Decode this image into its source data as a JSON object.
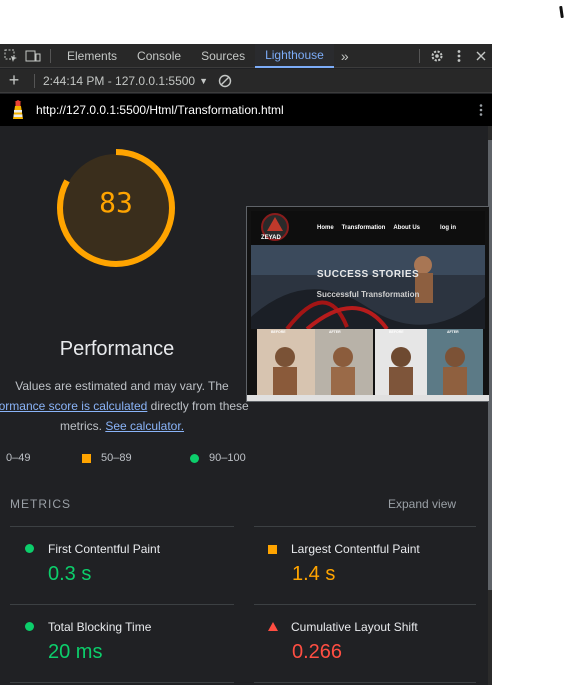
{
  "tabs": [
    "Elements",
    "Console",
    "Sources",
    "Lighthouse"
  ],
  "toolbar": {
    "report_time": "2:44:14 PM - 127.0.0.1:5500"
  },
  "url": "http://127.0.0.1:5500/Html/Transformation.html",
  "score": {
    "value": "83",
    "title": "Performance",
    "color": "#ffa400"
  },
  "note": {
    "line1": "Values are estimated and may vary. The",
    "link1": "formance score is calculated",
    "line2_rest": " directly from these",
    "line3": "metrics.",
    "link2": "See calculator."
  },
  "legend": {
    "red": "0–49",
    "orange": "50–89",
    "green": "90–100"
  },
  "screenshot": {
    "nav": [
      "Home",
      "Transformation",
      "About Us",
      "log in"
    ],
    "brand": "ZEYAD",
    "headline": "SUCCESS STORIES",
    "subheadline": "Successful Transformation",
    "tiles": [
      "BEFORE",
      "AFTER",
      "BEFORE",
      "AFTER"
    ]
  },
  "metrics": {
    "title": "METRICS",
    "expand": "Expand view",
    "items": [
      {
        "label": "First Contentful Paint",
        "value": "0.3 s",
        "status": "pass"
      },
      {
        "label": "Largest Contentful Paint",
        "value": "1.4 s",
        "status": "average"
      },
      {
        "label": "Total Blocking Time",
        "value": "20 ms",
        "status": "pass"
      },
      {
        "label": "Cumulative Layout Shift",
        "value": "0.266",
        "status": "fail"
      }
    ]
  },
  "colors": {
    "pass": "#0cce6b",
    "average": "#ffa400",
    "fail": "#ff4e42",
    "accent": "#7cacf8"
  }
}
